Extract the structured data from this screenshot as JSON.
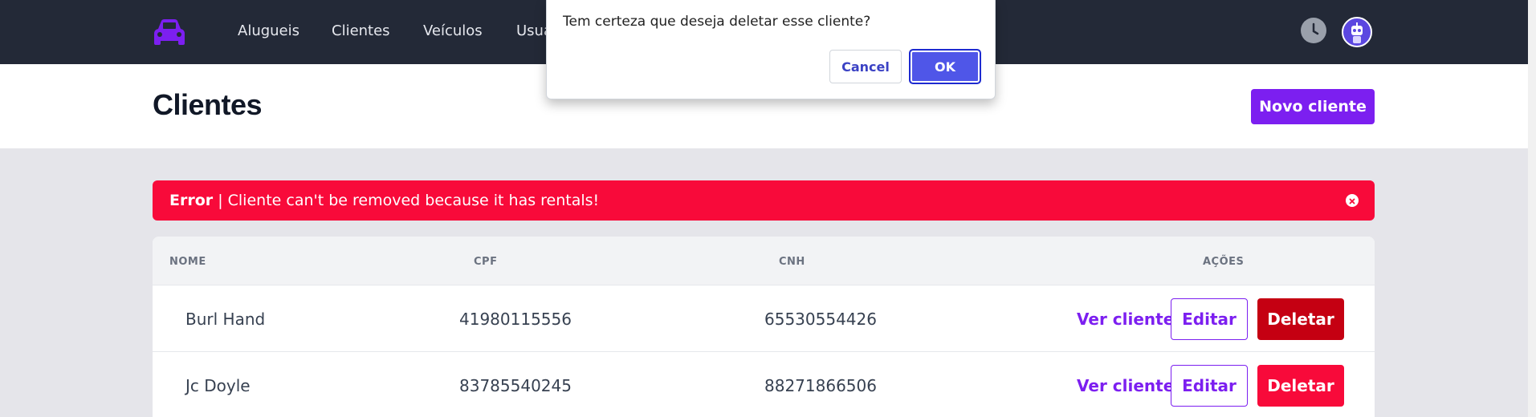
{
  "nav": {
    "items": [
      {
        "label": "Alugueis"
      },
      {
        "label": "Clientes"
      },
      {
        "label": "Veículos"
      },
      {
        "label": "Usuá"
      }
    ]
  },
  "header": {
    "title": "Clientes",
    "new_button_label": "Novo cliente"
  },
  "alert": {
    "strong": "Error",
    "message": " | Cliente can't be removed because it has rentals!"
  },
  "table": {
    "headers": [
      "NOME",
      "CPF",
      "CNH",
      "AÇÕES"
    ],
    "rows": [
      {
        "nome": "Burl Hand",
        "cpf": "41980115556",
        "cnh": "65530554426"
      },
      {
        "nome": "Jc Doyle",
        "cpf": "83785540245",
        "cnh": "88271866506"
      }
    ],
    "actions": {
      "ver": "Ver cliente",
      "editar": "Editar",
      "deletar": "Deletar"
    }
  },
  "dialog": {
    "message": "Tem certeza que deseja deletar esse cliente?",
    "cancel_label": "Cancel",
    "ok_label": "OK"
  },
  "colors": {
    "navbar": "#232937",
    "brand": "#7c1ff0",
    "error": "#f80a3a",
    "delete_pressed": "#c50012",
    "delete": "#f80a3a"
  },
  "icons": {
    "logo": "car-icon",
    "clock": "clock-icon",
    "avatar": "robot-avatar-icon",
    "alert_close": "close-circle-icon"
  }
}
